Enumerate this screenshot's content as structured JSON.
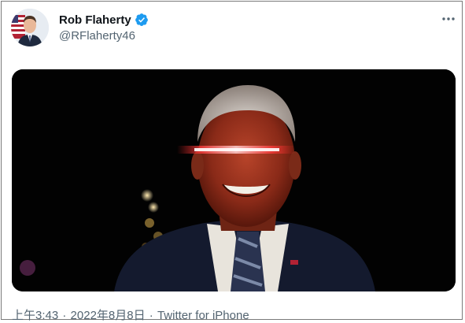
{
  "author": {
    "display_name": "Rob Flaherty",
    "handle": "@RFlaherty46",
    "verified": true,
    "avatar_icon": "profile-photo-with-flag"
  },
  "more_icon": "more-horizontal-icon",
  "media": {
    "description_icon": "edited-photo-red-glowing-eyes"
  },
  "meta": {
    "time": "上午3:43",
    "separator": "·",
    "date": "2022年8月8日",
    "source": "Twitter for iPhone"
  },
  "colors": {
    "verified_blue": "#1d9bf0",
    "secondary_text": "#536471",
    "primary_text": "#0f1419"
  }
}
